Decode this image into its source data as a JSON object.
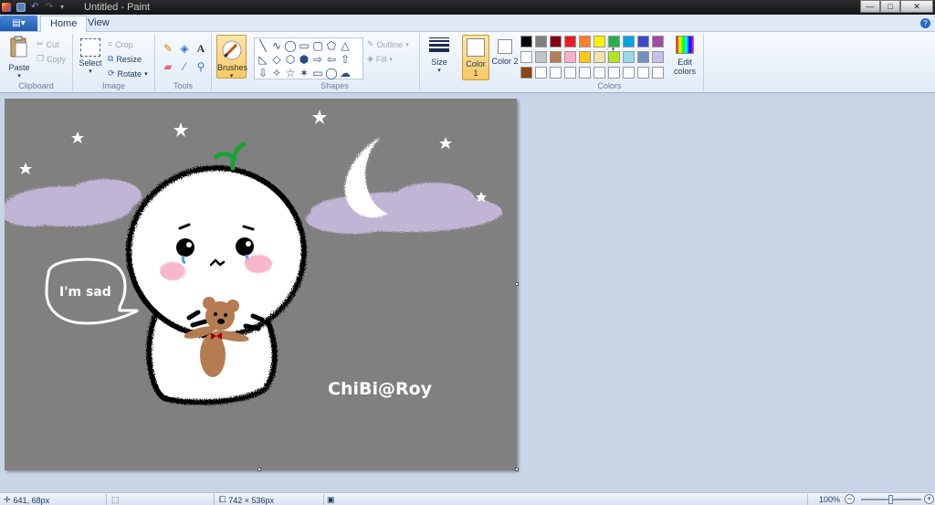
{
  "window": {
    "title": "Untitled - Paint",
    "minimize_label": "—",
    "maximize_label": "□",
    "close_label": "✕"
  },
  "tabs": {
    "app_menu_label": "▤▾",
    "home": "Home",
    "view": "View",
    "help_label": "?"
  },
  "ribbon": {
    "clipboard": {
      "label": "Clipboard",
      "paste": "Paste",
      "cut": "Cut",
      "copy": "Copy"
    },
    "image": {
      "label": "Image",
      "select": "Select",
      "crop": "Crop",
      "resize": "Resize",
      "rotate": "Rotate"
    },
    "tools": {
      "label": "Tools"
    },
    "brushes": {
      "label": "Brushes"
    },
    "shapes": {
      "label": "Shapes",
      "outline": "Outline",
      "fill": "Fill",
      "glyphs": [
        "╲",
        "∿",
        "◯",
        "▭",
        "▢",
        "⬠",
        "△",
        "◺",
        "◇",
        "⬡",
        "⬢",
        "⇨",
        "⇦",
        "⇧",
        "⇩",
        "✧",
        "☆",
        "✶",
        "▭",
        "◯",
        "☁"
      ]
    },
    "size": {
      "label": "Size"
    },
    "color1": {
      "label": "Color 1",
      "value": "#ffffff"
    },
    "color2": {
      "label": "Color 2",
      "value": "#ffffff"
    },
    "colors": {
      "label": "Colors",
      "edit_label": "Edit colors",
      "palette": [
        "#000000",
        "#7f7f7f",
        "#880015",
        "#ed1c24",
        "#ff7f27",
        "#fff200",
        "#22b14c",
        "#00a2e8",
        "#3f48cc",
        "#a349a4",
        "#ffffff",
        "#c3c3c3",
        "#b97a57",
        "#ffaec9",
        "#ffc90e",
        "#efe4b0",
        "#b5e61d",
        "#99d9ea",
        "#7092be",
        "#c8bfe7",
        "#8b4513",
        "#ffffff",
        "#ffffff",
        "#ffffff",
        "#ffffff",
        "#ffffff",
        "#ffffff",
        "#ffffff",
        "#ffffff",
        "#ffffff"
      ]
    }
  },
  "canvas": {
    "background": "#808080",
    "speech_text": "I'm sad",
    "signature": "ChiBi@Roy"
  },
  "status": {
    "cursor_pos": "641, 68px",
    "selection_size": "",
    "image_size": "742 × 536px",
    "zoom": "100%"
  }
}
